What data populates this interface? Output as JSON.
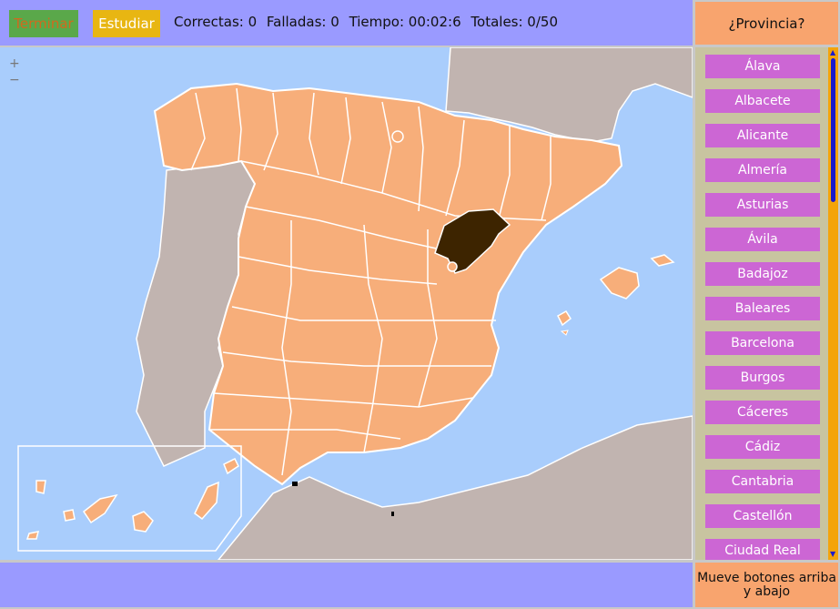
{
  "toolbar": {
    "terminar_label": "Terminar",
    "estudiar_label": "Estudiar",
    "correctas": "Correctas: 0",
    "falladas": "Falladas: 0",
    "tiempo": "Tiempo: 00:02:6",
    "totales": "Totales: 0/50"
  },
  "prompt": {
    "question": "¿Provincia?"
  },
  "map": {
    "zoom_in": "+",
    "zoom_out": "−",
    "colors": {
      "sea": "#a9cdfc",
      "land_other": "#c1b4b0",
      "province": "#f7ae7a",
      "highlight": "#3d2400",
      "border": "#ffffff"
    }
  },
  "provinces": {
    "items": [
      {
        "label": "Álava"
      },
      {
        "label": "Albacete"
      },
      {
        "label": "Alicante"
      },
      {
        "label": "Almería"
      },
      {
        "label": "Asturias"
      },
      {
        "label": "Ávila"
      },
      {
        "label": "Badajoz"
      },
      {
        "label": "Baleares"
      },
      {
        "label": "Barcelona"
      },
      {
        "label": "Burgos"
      },
      {
        "label": "Cáceres"
      },
      {
        "label": "Cádiz"
      },
      {
        "label": "Cantabria"
      },
      {
        "label": "Castellón"
      },
      {
        "label": "Ciudad Real"
      }
    ]
  },
  "footer": {
    "hint": "Mueve botones arriba y abajo"
  }
}
